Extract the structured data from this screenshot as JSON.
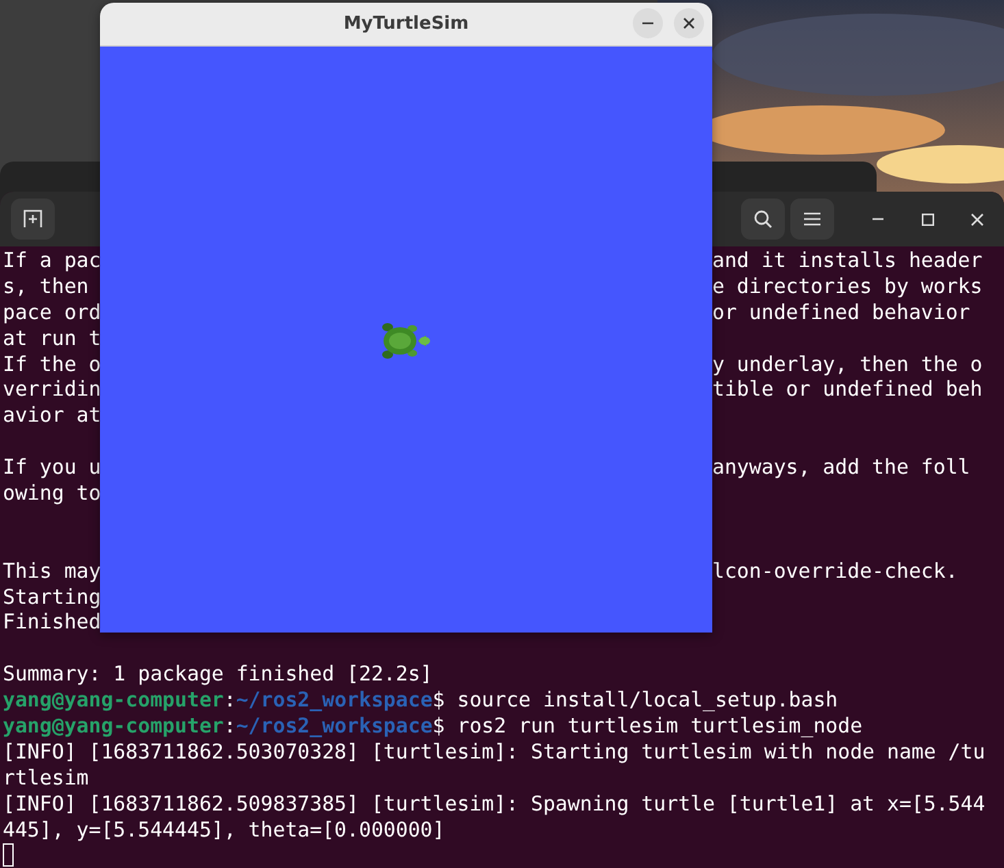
{
  "terminal": {
    "lines": [
      {
        "kind": "split",
        "left": "If a pac",
        "right": "and it installs header"
      },
      {
        "kind": "split",
        "left": "s, then",
        "right": "e directories by works"
      },
      {
        "kind": "split",
        "left": "pace ord",
        "right": "or undefined behavior"
      },
      {
        "kind": "split",
        "left": "at run t"
      },
      {
        "kind": "split",
        "left": "If the o",
        "right": "y underlay, then the o"
      },
      {
        "kind": "split",
        "left": "verridin",
        "right": "tible or undefined beh"
      },
      {
        "kind": "split",
        "left": "avior at"
      },
      {
        "kind": "blank"
      },
      {
        "kind": "split",
        "left": "If you u",
        "right": "anyways, add the foll"
      },
      {
        "kind": "split",
        "left": "owing to"
      },
      {
        "kind": "blank"
      },
      {
        "kind": "blank"
      },
      {
        "kind": "split",
        "left": "This may",
        "right": "lcon-override-check."
      },
      {
        "kind": "split",
        "left": "Starting"
      },
      {
        "kind": "split",
        "left": "Finished"
      },
      {
        "kind": "blank"
      },
      {
        "kind": "text",
        "text": "Summary: 1 package finished [22.2s]"
      },
      {
        "kind": "prompt",
        "user": "yang@yang-computer",
        "sep": ":",
        "path": "~/ros2_workspace",
        "symbol": "$",
        "command": " source install/local_setup.bash"
      },
      {
        "kind": "prompt",
        "user": "yang@yang-computer",
        "sep": ":",
        "path": "~/ros2_workspace",
        "symbol": "$",
        "command": " ros2 run turtlesim turtlesim_node"
      },
      {
        "kind": "text",
        "text": "[INFO] [1683711862.503070328] [turtlesim]: Starting turtlesim with node name /tu"
      },
      {
        "kind": "text",
        "text": "rtlesim"
      },
      {
        "kind": "text",
        "text": "[INFO] [1683711862.509837385] [turtlesim]: Spawning turtle [turtle1] at x=[5.544"
      },
      {
        "kind": "text",
        "text": "445], y=[5.544445], theta=[0.000000]"
      },
      {
        "kind": "cursor"
      }
    ]
  },
  "turtlesim_window": {
    "title": "MyTurtleSim"
  }
}
